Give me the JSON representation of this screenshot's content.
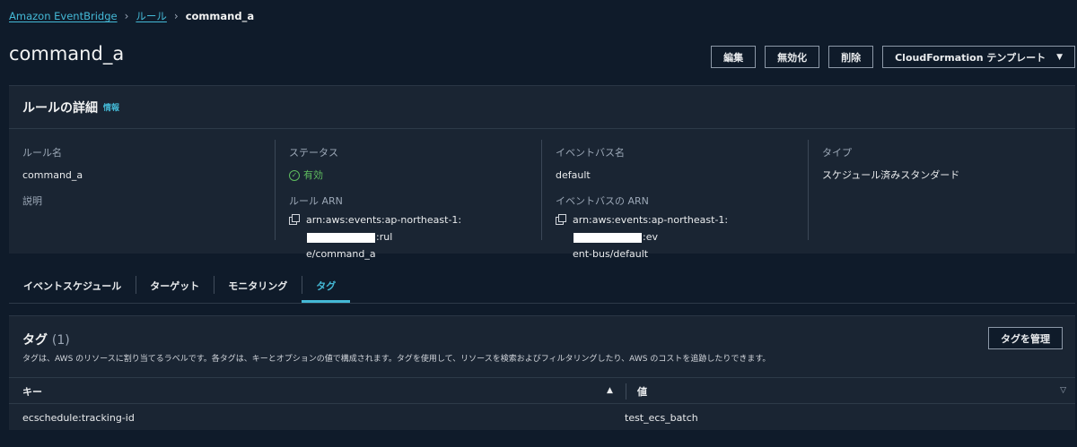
{
  "breadcrumb": {
    "root": "Amazon EventBridge",
    "section": "ルール",
    "current": "command_a"
  },
  "page": {
    "title": "command_a"
  },
  "actions": {
    "edit": "編集",
    "disable": "無効化",
    "delete": "削除",
    "cloudformation": "CloudFormation テンプレート"
  },
  "details": {
    "title": "ルールの詳細",
    "info": "情報",
    "rule_name_label": "ルール名",
    "rule_name": "command_a",
    "description_label": "説明",
    "status_label": "ステータス",
    "status": "有効",
    "rule_arn_label": "ルール ARN",
    "rule_arn_prefix": "arn:aws:events:ap-northeast-1:",
    "rule_arn_suffix1": ":rul",
    "rule_arn_suffix2": "e/command_a",
    "event_bus_name_label": "イベントバス名",
    "event_bus_name": "default",
    "event_bus_arn_label": "イベントバスの ARN",
    "event_bus_arn_prefix": "arn:aws:events:ap-northeast-1:",
    "event_bus_arn_suffix1": ":ev",
    "event_bus_arn_suffix2": "ent-bus/default",
    "type_label": "タイプ",
    "type": "スケジュール済みスタンダード"
  },
  "tabs": [
    {
      "label": "イベントスケジュール"
    },
    {
      "label": "ターゲット"
    },
    {
      "label": "モニタリング"
    },
    {
      "label": "タグ"
    }
  ],
  "tags": {
    "title": "タグ",
    "count": "(1)",
    "description": "タグは、AWS のリソースに割り当てるラベルです。各タグは、キーとオプションの値で構成されます。タグを使用して、リソースを検索およびフィルタリングしたり、AWS のコストを追跡したりできます。",
    "manage": "タグを管理",
    "columns": {
      "key": "キー",
      "value": "値"
    },
    "rows": [
      {
        "key": "ecschedule:tracking-id",
        "value": "test_ecs_batch"
      }
    ]
  },
  "colors": {
    "accent": "#44b9d6",
    "success": "#5fbd5f",
    "background": "#0f1b2a",
    "panel": "#1a2533"
  }
}
